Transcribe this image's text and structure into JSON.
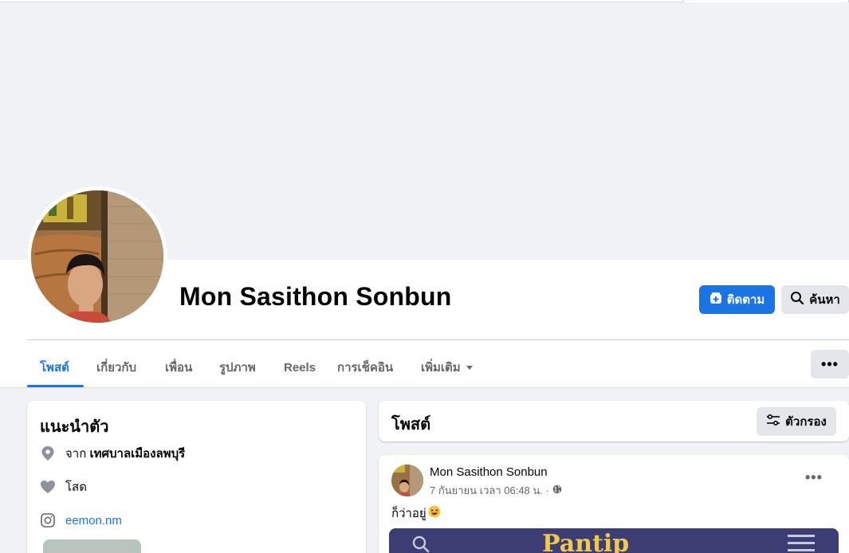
{
  "profile": {
    "name": "Mon Sasithon Sonbun"
  },
  "actions": {
    "follow_label": "ติดตาม",
    "search_label": "ค้นหา",
    "more_label": "•••"
  },
  "tabs": [
    {
      "label": "โพสต์",
      "active": true
    },
    {
      "label": "เกี่ยวกับ"
    },
    {
      "label": "เพื่อน"
    },
    {
      "label": "รูปภาพ"
    },
    {
      "label": "Reels"
    },
    {
      "label": "การเช็คอิน"
    },
    {
      "label": "เพิ่มเติม"
    }
  ],
  "intro": {
    "title": "แนะนำตัว",
    "hometown_prefix": "จาก",
    "hometown": "เทศบาลเมืองลพบุรี",
    "relationship": "โสด",
    "instagram": "eemon.nm"
  },
  "posts_section": {
    "title": "โพสต์",
    "filter_label": "ตัวกรอง"
  },
  "post": {
    "author": "Mon Sasithon Sonbun",
    "meta": "7 กันยายน เวลา 06:48 น. ·",
    "text": "ก็ว่าอยู่",
    "menu_label": "•••",
    "image_logo": "Pantip"
  },
  "colors": {
    "accent": "#1b74e4",
    "secondary_button": "#e4e6eb",
    "background": "#f0f2f5",
    "muted_text": "#65676b"
  },
  "icons": {
    "follow": "follow-plus-icon",
    "search": "search-icon",
    "location": "location-pin-icon",
    "relationship": "heart-icon",
    "instagram": "instagram-icon",
    "filter": "filter-sliders-icon",
    "privacy": "globe-icon",
    "dropdown": "caret-down-icon",
    "emoji": "laughing-emoji-icon"
  }
}
